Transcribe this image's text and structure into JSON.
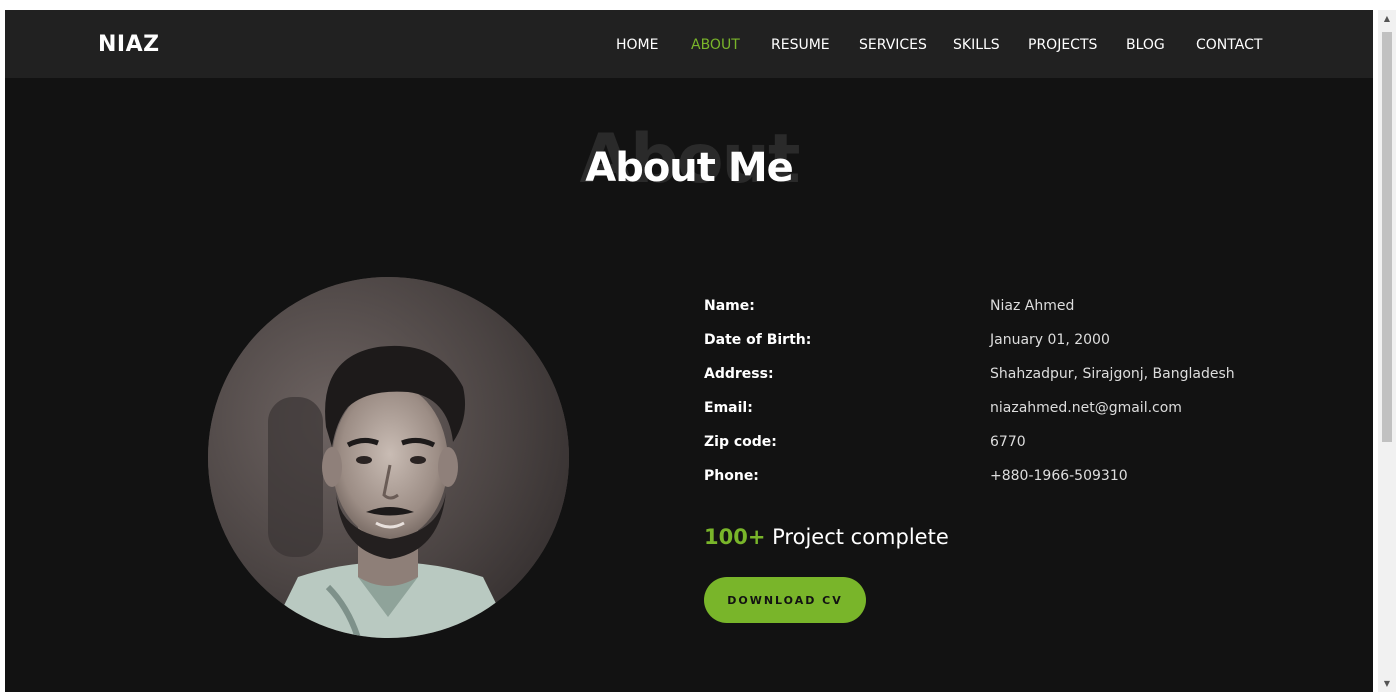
{
  "brand": "NIAZ",
  "nav": {
    "items": [
      {
        "label": "HOME"
      },
      {
        "label": "ABOUT"
      },
      {
        "label": "RESUME"
      },
      {
        "label": "SERVICES"
      },
      {
        "label": "SKILLS"
      },
      {
        "label": "PROJECTS"
      },
      {
        "label": "BLOG"
      },
      {
        "label": "CONTACT"
      }
    ],
    "active": "ABOUT"
  },
  "section": {
    "title_bg": "About",
    "title": "About Me"
  },
  "profile": {
    "photo_icon": "profile-photo",
    "rows": [
      {
        "label": "Name:",
        "value": "Niaz Ahmed"
      },
      {
        "label": "Date of Birth:",
        "value": "January 01, 2000"
      },
      {
        "label": "Address:",
        "value": "Shahzadpur, Sirajgonj, Bangladesh"
      },
      {
        "label": "Email:",
        "value": "niazahmed.net@gmail.com"
      },
      {
        "label": "Zip code:",
        "value": "6770"
      },
      {
        "label": "Phone:",
        "value": "+880-1966-509310"
      }
    ],
    "projects_count": "100+",
    "projects_text": "Project complete",
    "download_label": "DOWNLOAD CV"
  },
  "colors": {
    "accent": "#79b52a",
    "background": "#121212",
    "navbar": "#212121"
  }
}
